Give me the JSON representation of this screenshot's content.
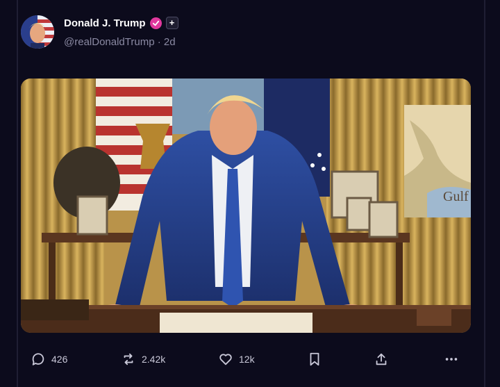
{
  "post": {
    "author": {
      "display_name": "Donald J. Trump",
      "handle": "@realDonaldTrump",
      "separator": "·",
      "age": "2d",
      "verified_icon": "verified-badge-icon",
      "follow_icon": "plus-icon"
    },
    "image": {
      "map_label": "Gulf"
    },
    "actions": {
      "replies": "426",
      "reposts": "2.42k",
      "likes": "12k",
      "bookmark_icon": "bookmark-icon",
      "share_icon": "share-icon",
      "more_icon": "more-icon"
    }
  },
  "colors": {
    "background": "#0c0b1c",
    "badge": "#e0389d",
    "text_primary": "#ffffff",
    "text_secondary": "#8b8aa3"
  }
}
